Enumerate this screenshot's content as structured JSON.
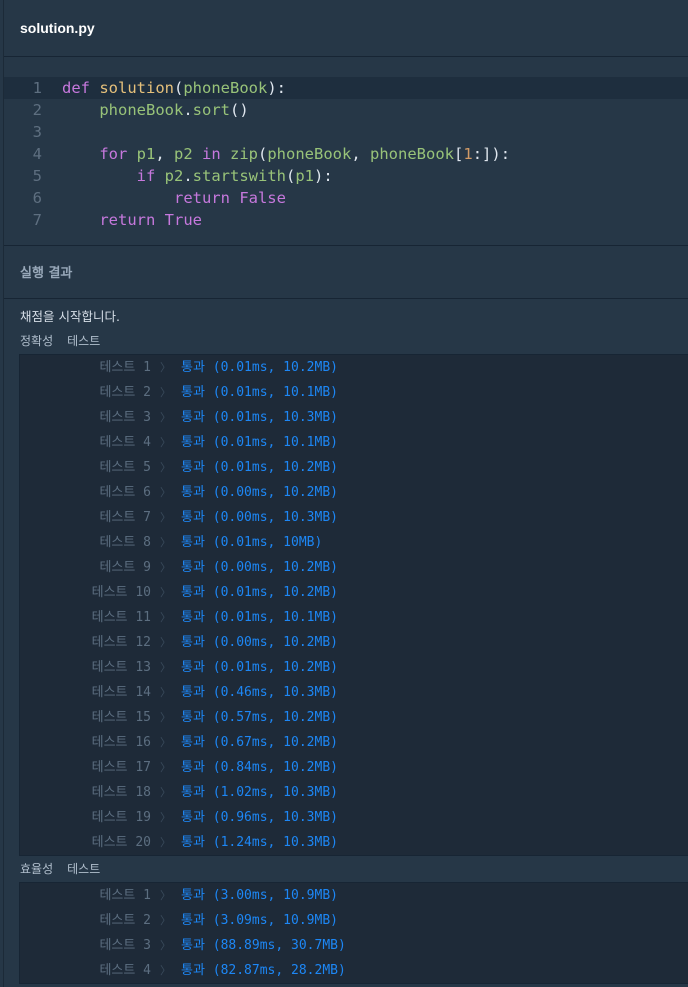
{
  "header": {
    "title": "solution.py"
  },
  "editor": {
    "lines": [
      {
        "num": "1",
        "tokens": [
          [
            "kw",
            "def "
          ],
          [
            "fn",
            "solution"
          ],
          [
            "pn",
            "("
          ],
          [
            "arg",
            "phoneBook"
          ],
          [
            "pn",
            "):"
          ]
        ]
      },
      {
        "num": "2",
        "tokens": [
          [
            "pn",
            "    "
          ],
          [
            "arg",
            "phoneBook"
          ],
          [
            "pn",
            "."
          ],
          [
            "arg",
            "sort"
          ],
          [
            "pn",
            "()"
          ]
        ]
      },
      {
        "num": "3",
        "tokens": []
      },
      {
        "num": "4",
        "tokens": [
          [
            "pn",
            "    "
          ],
          [
            "kw",
            "for "
          ],
          [
            "arg",
            "p1"
          ],
          [
            "pn",
            ", "
          ],
          [
            "arg",
            "p2"
          ],
          [
            "kw",
            " in "
          ],
          [
            "arg",
            "zip"
          ],
          [
            "pn",
            "("
          ],
          [
            "arg",
            "phoneBook"
          ],
          [
            "pn",
            ", "
          ],
          [
            "arg",
            "phoneBook"
          ],
          [
            "pn",
            "["
          ],
          [
            "num",
            "1"
          ],
          [
            "pn",
            ":]):"
          ]
        ]
      },
      {
        "num": "5",
        "tokens": [
          [
            "pn",
            "        "
          ],
          [
            "kw",
            "if "
          ],
          [
            "arg",
            "p2"
          ],
          [
            "pn",
            "."
          ],
          [
            "arg",
            "startswith"
          ],
          [
            "pn",
            "("
          ],
          [
            "arg",
            "p1"
          ],
          [
            "pn",
            "):"
          ]
        ]
      },
      {
        "num": "6",
        "tokens": [
          [
            "pn",
            "            "
          ],
          [
            "kw",
            "return "
          ],
          [
            "kw",
            "False"
          ]
        ]
      },
      {
        "num": "7",
        "tokens": [
          [
            "pn",
            "    "
          ],
          [
            "kw",
            "return "
          ],
          [
            "kw",
            "True"
          ]
        ]
      }
    ]
  },
  "result": {
    "heading": "실행 결과",
    "start_message": "채점을 시작합니다.",
    "accuracy": {
      "label_a": "정확성",
      "label_b": "테스트",
      "tests": [
        {
          "name": "테스트 1",
          "result": "통과 (0.01ms, 10.2MB)"
        },
        {
          "name": "테스트 2",
          "result": "통과 (0.01ms, 10.1MB)"
        },
        {
          "name": "테스트 3",
          "result": "통과 (0.01ms, 10.3MB)"
        },
        {
          "name": "테스트 4",
          "result": "통과 (0.01ms, 10.1MB)"
        },
        {
          "name": "테스트 5",
          "result": "통과 (0.01ms, 10.2MB)"
        },
        {
          "name": "테스트 6",
          "result": "통과 (0.00ms, 10.2MB)"
        },
        {
          "name": "테스트 7",
          "result": "통과 (0.00ms, 10.3MB)"
        },
        {
          "name": "테스트 8",
          "result": "통과 (0.01ms, 10MB)"
        },
        {
          "name": "테스트 9",
          "result": "통과 (0.00ms, 10.2MB)"
        },
        {
          "name": "테스트 10",
          "result": "통과 (0.01ms, 10.2MB)"
        },
        {
          "name": "테스트 11",
          "result": "통과 (0.01ms, 10.1MB)"
        },
        {
          "name": "테스트 12",
          "result": "통과 (0.00ms, 10.2MB)"
        },
        {
          "name": "테스트 13",
          "result": "통과 (0.01ms, 10.2MB)"
        },
        {
          "name": "테스트 14",
          "result": "통과 (0.46ms, 10.3MB)"
        },
        {
          "name": "테스트 15",
          "result": "통과 (0.57ms, 10.2MB)"
        },
        {
          "name": "테스트 16",
          "result": "통과 (0.67ms, 10.2MB)"
        },
        {
          "name": "테스트 17",
          "result": "통과 (0.84ms, 10.2MB)"
        },
        {
          "name": "테스트 18",
          "result": "통과 (1.02ms, 10.3MB)"
        },
        {
          "name": "테스트 19",
          "result": "통과 (0.96ms, 10.3MB)"
        },
        {
          "name": "테스트 20",
          "result": "통과 (1.24ms, 10.3MB)"
        }
      ]
    },
    "efficiency": {
      "label_a": "효율성",
      "label_b": "테스트",
      "tests": [
        {
          "name": "테스트 1",
          "result": "통과 (3.00ms, 10.9MB)"
        },
        {
          "name": "테스트 2",
          "result": "통과 (3.09ms, 10.9MB)"
        },
        {
          "name": "테스트 3",
          "result": "통과 (88.89ms, 30.7MB)"
        },
        {
          "name": "테스트 4",
          "result": "통과 (82.87ms, 28.2MB)"
        }
      ]
    },
    "chevron": "〉"
  },
  "colors": {
    "background": "#263747",
    "pass": "#1d87f5",
    "keyword": "#c678dd",
    "function": "#e5c07b",
    "identifier": "#98c379"
  }
}
